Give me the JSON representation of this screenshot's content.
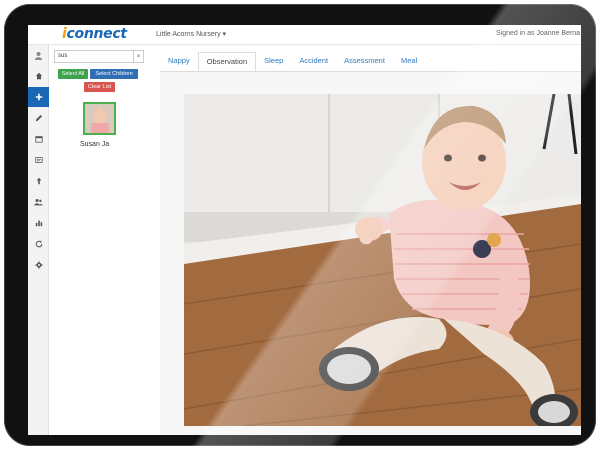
{
  "app": {
    "logo_text": "iconnect",
    "nursery": "Little Acorns Nursery ▾",
    "signed_in": "Signed in as Joanne Berna"
  },
  "sidebar": {
    "icons": [
      "user-icon",
      "home-icon",
      "plus-icon",
      "pencil-icon",
      "calendar-icon",
      "card-icon",
      "upload-icon",
      "users-icon",
      "chart-icon",
      "refresh-icon",
      "gear-icon"
    ]
  },
  "children_panel": {
    "search_value": "sus",
    "clear_symbol": "×",
    "select_all_label": "Select All",
    "select_children_label": "Select Children",
    "clear_list_label": "Clear List",
    "child_name": "Susan Ja"
  },
  "tabs": [
    "Nappy",
    "Observation",
    "Sleep",
    "Accident",
    "Assessment",
    "Meal"
  ],
  "active_tab": "Observation",
  "colors": {
    "brand_blue": "#1a67b5",
    "accent_orange": "#f39c12",
    "button_green": "#3fa34d",
    "button_blue": "#2f6db5",
    "button_red": "#d9534f",
    "selected_border": "#4caf50"
  }
}
